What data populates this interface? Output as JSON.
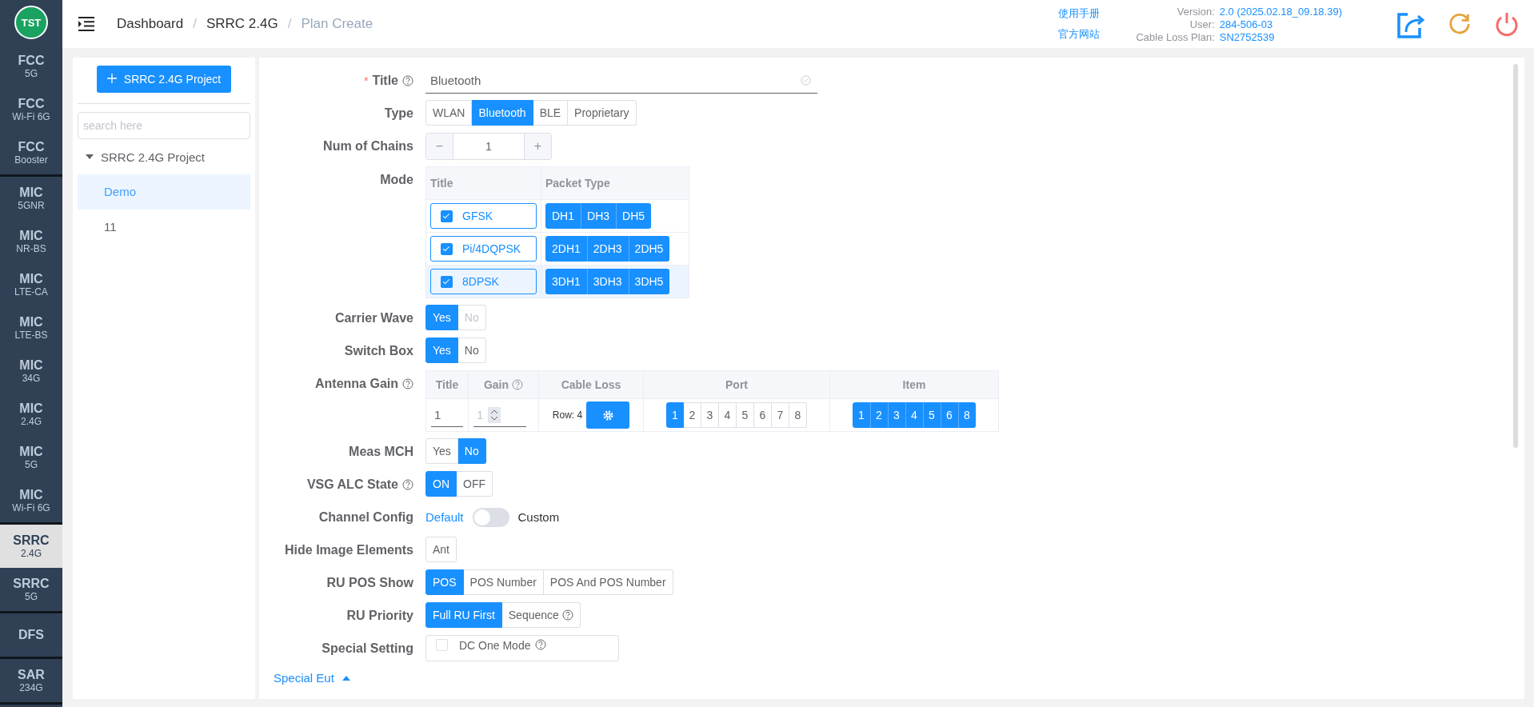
{
  "logo": {
    "text": "TST"
  },
  "sidebar": {
    "groups": [
      {
        "items": [
          {
            "top": "FCC",
            "sub": "5G",
            "selected": false
          },
          {
            "top": "FCC",
            "sub": "Wi-Fi 6G",
            "selected": false
          },
          {
            "top": "FCC",
            "sub": "Booster",
            "selected": false
          }
        ]
      },
      {
        "items": [
          {
            "top": "MIC",
            "sub": "5GNR",
            "selected": false
          },
          {
            "top": "MIC",
            "sub": "NR-BS",
            "selected": false
          },
          {
            "top": "MIC",
            "sub": "LTE-CA",
            "selected": false
          },
          {
            "top": "MIC",
            "sub": "LTE-BS",
            "selected": false
          },
          {
            "top": "MIC",
            "sub": "34G",
            "selected": false
          },
          {
            "top": "MIC",
            "sub": "2.4G",
            "selected": false
          },
          {
            "top": "MIC",
            "sub": "5G",
            "selected": false
          },
          {
            "top": "MIC",
            "sub": "Wi-Fi 6G",
            "selected": false
          }
        ]
      },
      {
        "items": [
          {
            "top": "SRRC",
            "sub": "2.4G",
            "selected": true
          },
          {
            "top": "SRRC",
            "sub": "5G",
            "selected": false
          }
        ]
      },
      {
        "items": [
          {
            "top": "DFS",
            "selected": false
          }
        ]
      },
      {
        "items": [
          {
            "top": "SAR",
            "sub": "234G",
            "selected": false
          }
        ]
      }
    ]
  },
  "breadcrumb": [
    {
      "label": "Dashboard",
      "current": false
    },
    {
      "separator": "/",
      "label": "SRRC 2.4G",
      "current": false
    },
    {
      "separator": "/",
      "label": "Plan Create",
      "current": true
    }
  ],
  "header_links": [
    "使用手册",
    "官方网站"
  ],
  "info": [
    {
      "label": "Version:",
      "value": "2.0 (2025.02.18_09.18.39)"
    },
    {
      "label": "User:",
      "value": "284-506-03"
    },
    {
      "label": "Cable Loss Plan:",
      "value": "SN2752539"
    }
  ],
  "project_panel": {
    "add_button": "SRRC 2.4G Project",
    "search": {
      "placeholder": "search here"
    },
    "tree": [
      {
        "label": "SRRC 2.4G Project",
        "expanded": true,
        "children": [
          {
            "label": "Demo",
            "selected": true
          },
          {
            "label": "11",
            "selected": false
          }
        ]
      }
    ]
  },
  "form": {
    "fields": [
      {
        "kind": "text",
        "label": "Title",
        "required_mark": "*",
        "help": true,
        "value": "Bluetooth"
      },
      {
        "kind": "segmented",
        "label": "Type",
        "help": false,
        "options": [
          {
            "label": "WLAN",
            "selected": false
          },
          {
            "label": "Bluetooth",
            "selected": true
          },
          {
            "label": "BLE",
            "selected": false
          },
          {
            "label": "Proprietary",
            "selected": false
          }
        ]
      },
      {
        "kind": "stepper",
        "label": "Num of Chains",
        "help": false,
        "value": "1",
        "minus": "−",
        "plus": "+"
      },
      {
        "kind": "mode",
        "label": "Mode",
        "help": false,
        "columns": [
          "Title",
          "Packet Type"
        ],
        "rows": [
          {
            "title": "GFSK",
            "checked": true,
            "selected": false,
            "packets": [
              {
                "label": "DH1",
                "selected": true
              },
              {
                "label": "DH3",
                "selected": true
              },
              {
                "label": "DH5",
                "selected": true
              }
            ]
          },
          {
            "title": "Pi/4DQPSK",
            "checked": true,
            "selected": false,
            "packets": [
              {
                "label": "2DH1",
                "selected": true
              },
              {
                "label": "2DH3",
                "selected": true
              },
              {
                "label": "2DH5",
                "selected": true
              }
            ]
          },
          {
            "title": "8DPSK",
            "checked": true,
            "selected": true,
            "packets": [
              {
                "label": "3DH1",
                "selected": true
              },
              {
                "label": "3DH3",
                "selected": true
              },
              {
                "label": "3DH5",
                "selected": true
              }
            ]
          }
        ]
      },
      {
        "kind": "segmented",
        "label": "Carrier Wave",
        "help": false,
        "options": [
          {
            "label": "Yes",
            "selected": true,
            "disabled": false
          },
          {
            "label": "No",
            "selected": false,
            "disabled": true
          }
        ]
      },
      {
        "kind": "segmented",
        "label": "Switch Box",
        "help": false,
        "options": [
          {
            "label": "Yes",
            "selected": true
          },
          {
            "label": "No",
            "selected": false
          }
        ]
      },
      {
        "kind": "antenna",
        "label": "Antenna Gain",
        "help": true,
        "columns": [
          {
            "label": "Title",
            "help": false
          },
          {
            "label": "Gain",
            "help": true
          },
          {
            "label": "Cable Loss",
            "help": false
          },
          {
            "label": "Port",
            "help": false
          },
          {
            "label": "Item",
            "help": false
          }
        ],
        "title_value": "1",
        "gain_value": "1",
        "cable_loss": "Row: 4",
        "ports": [
          {
            "label": "1",
            "selected": true
          },
          {
            "label": "2",
            "selected": false
          },
          {
            "label": "3",
            "selected": false
          },
          {
            "label": "4",
            "selected": false
          },
          {
            "label": "5",
            "selected": false
          },
          {
            "label": "6",
            "selected": false
          },
          {
            "label": "7",
            "selected": false
          },
          {
            "label": "8",
            "selected": false
          }
        ],
        "items": [
          {
            "label": "1",
            "selected": true
          },
          {
            "label": "2",
            "selected": true
          },
          {
            "label": "3",
            "selected": true
          },
          {
            "label": "4",
            "selected": true
          },
          {
            "label": "5",
            "selected": true
          },
          {
            "label": "6",
            "selected": true
          },
          {
            "label": "8",
            "selected": true
          }
        ]
      },
      {
        "kind": "segmented",
        "label": "Meas MCH",
        "help": false,
        "options": [
          {
            "label": "Yes",
            "selected": false
          },
          {
            "label": "No",
            "selected": true
          }
        ]
      },
      {
        "kind": "segmented",
        "label": "VSG ALC State",
        "help": true,
        "options": [
          {
            "label": "ON",
            "selected": true
          },
          {
            "label": "OFF",
            "selected": false
          }
        ]
      },
      {
        "kind": "switch",
        "label": "Channel Config",
        "help": false,
        "left": "Default",
        "right": "Custom",
        "on": false
      },
      {
        "kind": "segmented",
        "label": "Hide Image Elements",
        "help": false,
        "options": [
          {
            "label": "Ant",
            "selected": false
          }
        ]
      },
      {
        "kind": "segmented",
        "label": "RU POS Show",
        "help": false,
        "options": [
          {
            "label": "POS",
            "selected": true
          },
          {
            "label": "POS Number",
            "selected": false
          },
          {
            "label": "POS And POS Number",
            "selected": false
          }
        ]
      },
      {
        "kind": "segmented",
        "label": "RU Priority",
        "help": false,
        "options": [
          {
            "label": "Full RU First",
            "selected": true,
            "help": false
          },
          {
            "label": "Sequence",
            "selected": false,
            "help": true
          }
        ]
      },
      {
        "kind": "checkbox",
        "label": "Special Setting",
        "help": false,
        "option": {
          "label": "DC One Mode",
          "checked": false,
          "help": true
        }
      }
    ]
  },
  "special_eut": {
    "label": "Special Eut",
    "expanded": true
  }
}
